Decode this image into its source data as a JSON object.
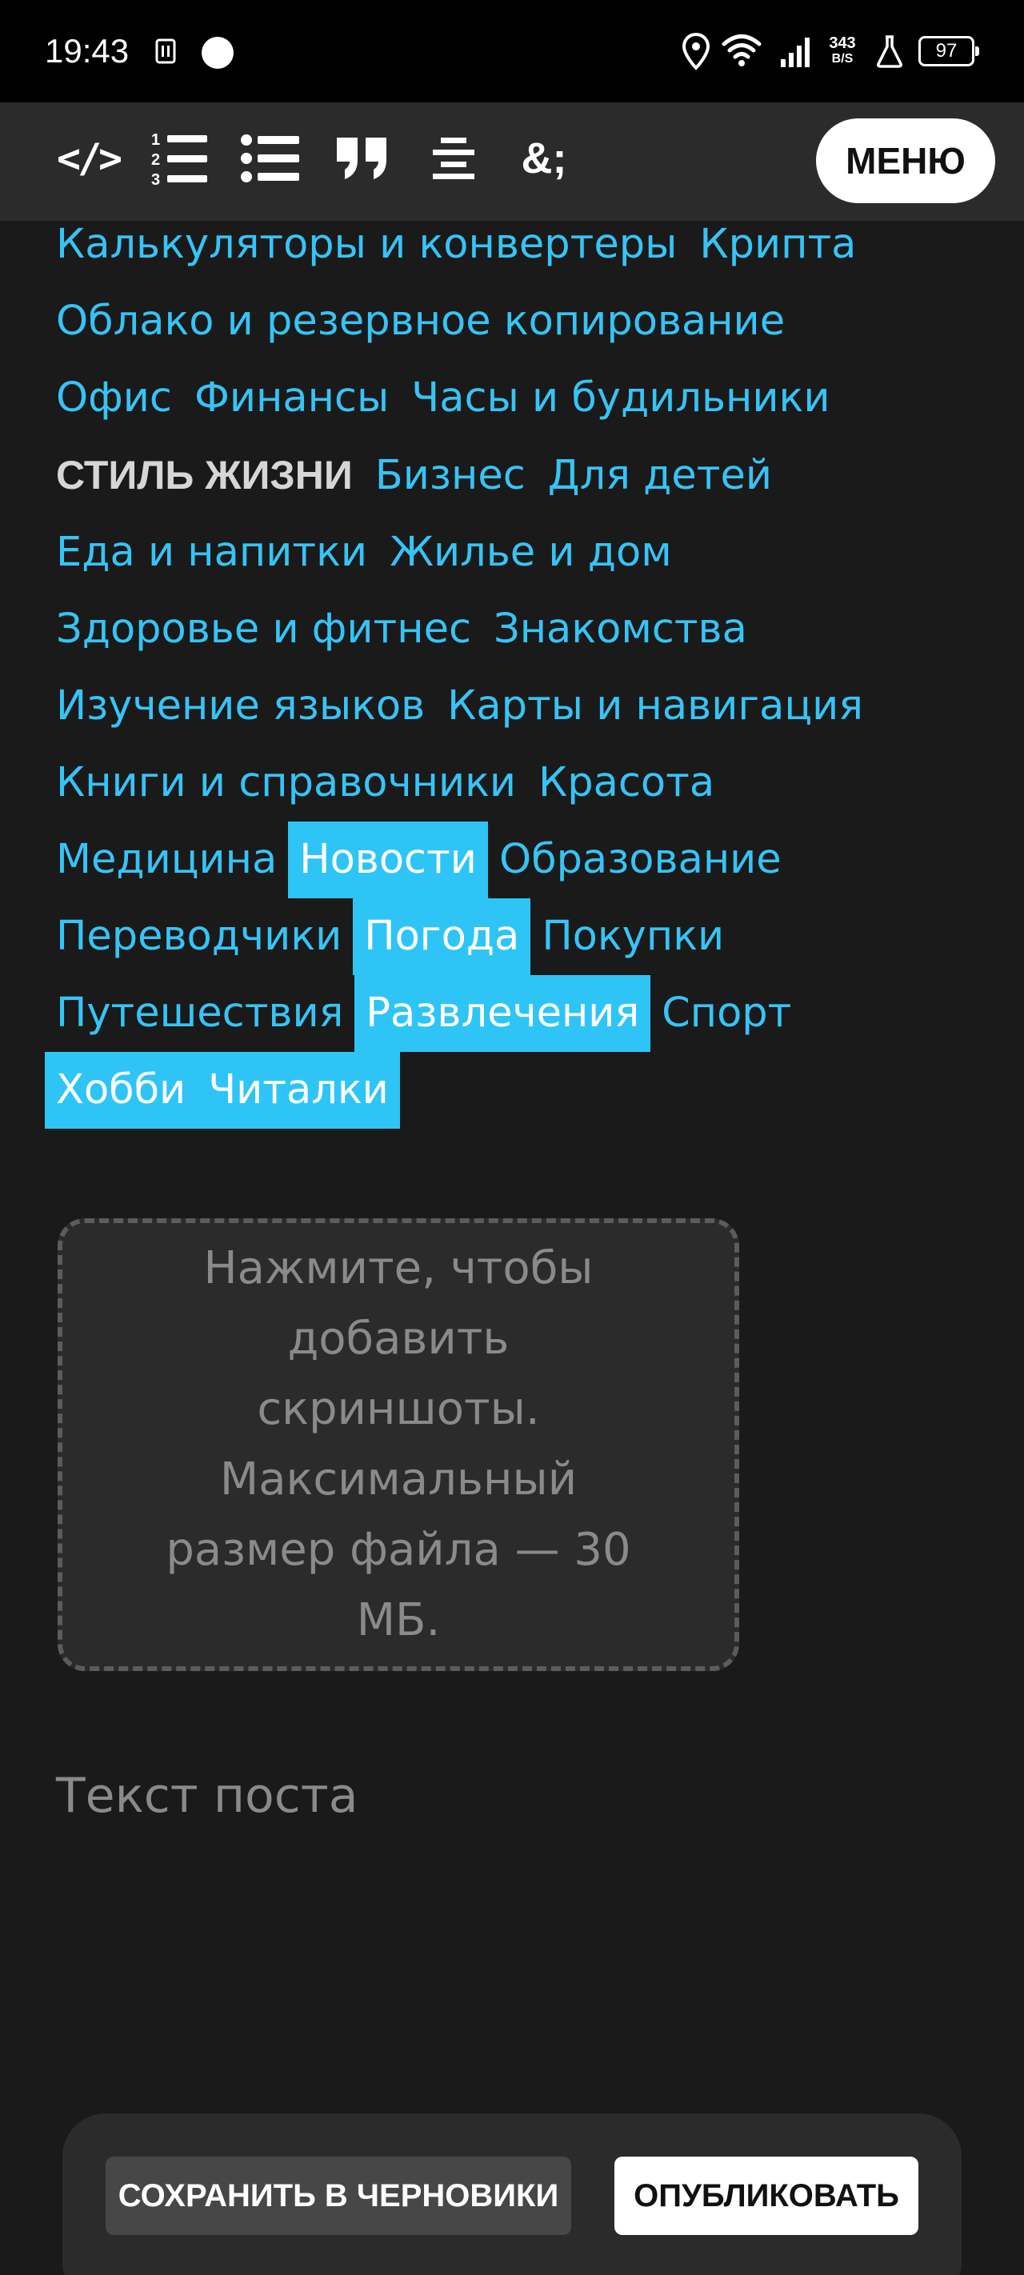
{
  "status_bar": {
    "time": "19:43",
    "network_speed_value": "343",
    "network_speed_unit": "B/S",
    "battery": "97"
  },
  "toolbar": {
    "code_label": "</>",
    "ordered_list_icon": "ordered-list-icon",
    "bullet_list_icon": "bullet-list-icon",
    "quote_icon": "quote-icon",
    "align_center_icon": "align-center-icon",
    "entity_label": "&;",
    "menu_label": "МЕНЮ"
  },
  "categories": {
    "colors": {
      "tag": "#36c4f6",
      "selected_bg": "#2ec5f6",
      "heading": "#d6d6d6"
    },
    "rows": [
      [
        {
          "label": "Калькуляторы и конвертеры",
          "selected": false
        },
        {
          "label": "Крипта",
          "selected": false
        }
      ],
      [
        {
          "label": "Облако и резервное копирование",
          "selected": false
        }
      ],
      [
        {
          "label": "Офис",
          "selected": false
        },
        {
          "label": "Финансы",
          "selected": false
        },
        {
          "label": "Часы и будильники",
          "selected": false
        }
      ],
      [
        {
          "label": "СТИЛЬ ЖИЗНИ",
          "heading": true
        },
        {
          "label": "Бизнес",
          "selected": false
        },
        {
          "label": "Для детей",
          "selected": false
        }
      ],
      [
        {
          "label": "Еда и напитки",
          "selected": false
        },
        {
          "label": "Жилье и дом",
          "selected": false
        }
      ],
      [
        {
          "label": "Здоровье и фитнес",
          "selected": false
        },
        {
          "label": "Знакомства",
          "selected": false
        }
      ],
      [
        {
          "label": "Изучение языков",
          "selected": false
        },
        {
          "label": "Карты и навигация",
          "selected": false
        }
      ],
      [
        {
          "label": "Книги и справочники",
          "selected": false
        },
        {
          "label": "Красота",
          "selected": false
        }
      ],
      [
        {
          "label": "Медицина",
          "selected": false
        },
        {
          "label": "Новости",
          "selected": true
        },
        {
          "label": "Образование",
          "selected": false
        }
      ],
      [
        {
          "label": "Переводчики",
          "selected": false
        },
        {
          "label": "Погода",
          "selected": true
        },
        {
          "label": "Покупки",
          "selected": false
        }
      ],
      [
        {
          "label": "Путешествия",
          "selected": false
        },
        {
          "label": "Развлечения",
          "selected": true
        },
        {
          "label": "Спорт",
          "selected": false
        }
      ],
      [
        {
          "label": "Хобби",
          "selected": true
        },
        {
          "label": "Читалки",
          "selected": true
        }
      ]
    ]
  },
  "upload": {
    "text": "Нажмите, чтобы добавить скриншоты. Максимальный размер файла — 30 МБ."
  },
  "post": {
    "placeholder": "Текст поста"
  },
  "actions": {
    "save_draft_label": "СОХРАНИТЬ В ЧЕРНОВИКИ",
    "publish_label": "ОПУБЛИКОВАТЬ"
  }
}
